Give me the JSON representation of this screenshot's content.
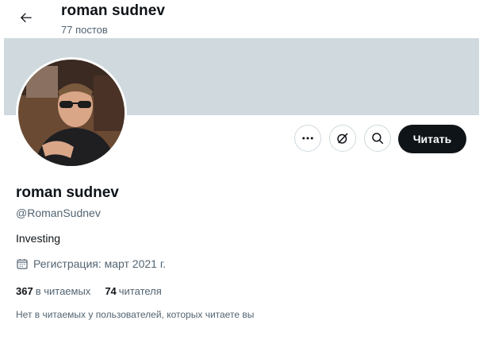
{
  "header": {
    "title": "roman sudnev",
    "posts_count": "77 постов"
  },
  "profile": {
    "display_name": "roman sudnev",
    "handle": "@RomanSudnev",
    "bio": "Investing",
    "joined": "Регистрация: март 2021 г.",
    "following_count": "367",
    "following_label": "в читаемых",
    "followers_count": "74",
    "followers_label": "читателя",
    "mutual_text": "Нет в читаемых у пользователей, которых читаете вы"
  },
  "actions": {
    "more_icon": "more-dots-icon",
    "grok_icon": "grok-icon",
    "search_icon": "search-icon",
    "follow_label": "Читать"
  },
  "colors": {
    "banner": "#cfd9de",
    "follow_bg": "#0f1419",
    "secondary_text": "#536471"
  }
}
